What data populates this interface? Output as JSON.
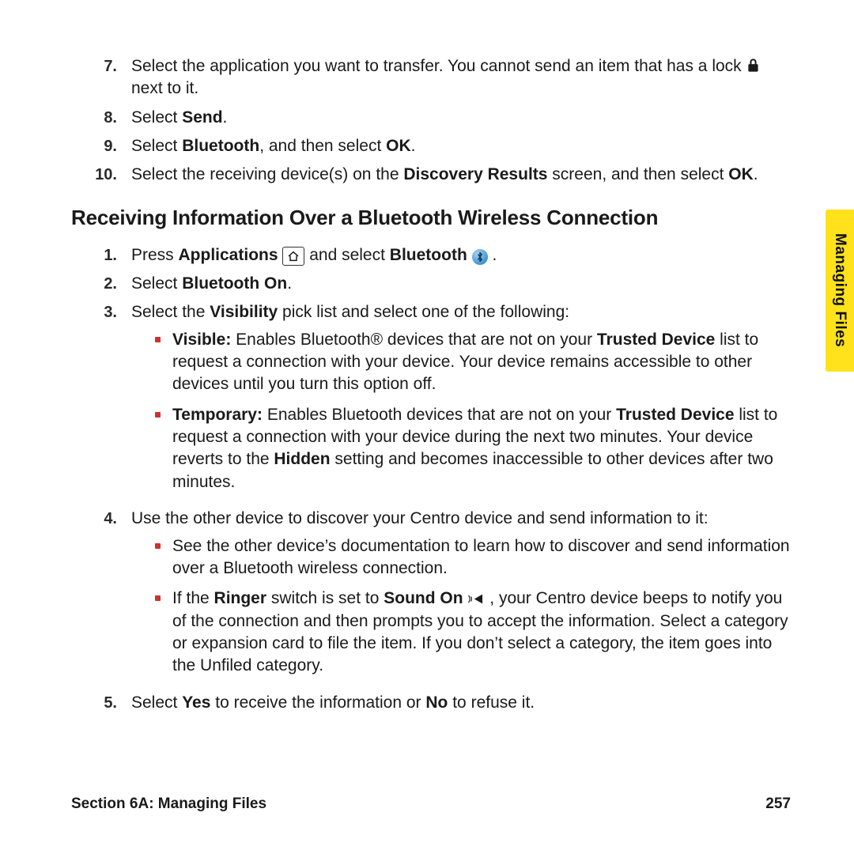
{
  "topList": {
    "start": 7,
    "items": [
      {
        "n": "7.",
        "parts": [
          {
            "t": "Select the application you want to transfer. You cannot send an item that has a lock "
          },
          {
            "icon": "lock"
          },
          {
            "t": " next to it."
          }
        ]
      },
      {
        "n": "8.",
        "parts": [
          {
            "t": "Select "
          },
          {
            "b": "Send"
          },
          {
            "t": "."
          }
        ]
      },
      {
        "n": "9.",
        "parts": [
          {
            "t": "Select "
          },
          {
            "b": "Bluetooth"
          },
          {
            "t": ", and then select "
          },
          {
            "b": "OK"
          },
          {
            "t": "."
          }
        ]
      },
      {
        "n": "10.",
        "parts": [
          {
            "t": "Select the receiving device(s) on the "
          },
          {
            "b": "Discovery Results"
          },
          {
            "t": " screen, and then select "
          },
          {
            "b": "OK"
          },
          {
            "t": "."
          }
        ]
      }
    ]
  },
  "heading": "Receiving Information Over a Bluetooth Wireless Connection",
  "receiveList": {
    "items": [
      {
        "n": "1.",
        "parts": [
          {
            "t": "Press "
          },
          {
            "b": "Applications"
          },
          {
            "t": " "
          },
          {
            "icon": "home"
          },
          {
            "t": " and select "
          },
          {
            "b": "Bluetooth"
          },
          {
            "t": " "
          },
          {
            "icon": "bt"
          },
          {
            "t": " ."
          }
        ]
      },
      {
        "n": "2.",
        "parts": [
          {
            "t": "Select "
          },
          {
            "b": "Bluetooth On"
          },
          {
            "t": "."
          }
        ]
      },
      {
        "n": "3.",
        "parts": [
          {
            "t": "Select the "
          },
          {
            "b": "Visibility"
          },
          {
            "t": " pick list and select one of the following:"
          }
        ],
        "bullets": [
          {
            "parts": [
              {
                "b": "Visible:"
              },
              {
                "t": " Enables Bluetooth® devices that are not on your "
              },
              {
                "b": "Trusted Device"
              },
              {
                "t": " list to request a connection with your device. Your device remains accessible to other devices until you turn this option off."
              }
            ]
          },
          {
            "parts": [
              {
                "b": "Temporary:"
              },
              {
                "t": " Enables Bluetooth devices that are not on your "
              },
              {
                "b": "Trusted Device"
              },
              {
                "t": " list to request a connection with your device during the next two minutes. Your device reverts to the "
              },
              {
                "b": "Hidden"
              },
              {
                "t": " setting and becomes inaccessible to other devices after two minutes."
              }
            ]
          }
        ]
      },
      {
        "n": "4.",
        "parts": [
          {
            "t": "Use the other device to discover your Centro device and send information to it:"
          }
        ],
        "bullets": [
          {
            "parts": [
              {
                "t": "See the other device’s documentation to learn how to discover and send information over a Bluetooth wireless connection."
              }
            ]
          },
          {
            "parts": [
              {
                "t": "If the "
              },
              {
                "b": "Ringer"
              },
              {
                "t": " switch is set to "
              },
              {
                "b": "Sound On"
              },
              {
                "t": " "
              },
              {
                "icon": "sound"
              },
              {
                "t": ", your Centro device beeps to notify you of the connection and then prompts you to accept the information. Select a category or expansion card to file the item. If you don’t select a category, the item goes into the Unfiled category."
              }
            ]
          }
        ]
      },
      {
        "n": "5.",
        "parts": [
          {
            "t": "Select "
          },
          {
            "b": "Yes"
          },
          {
            "t": " to receive the information or "
          },
          {
            "b": "No"
          },
          {
            "t": " to refuse it."
          }
        ]
      }
    ]
  },
  "sidetab": "Managing Files",
  "footer": {
    "left": "Section 6A: Managing Files",
    "right": "257"
  }
}
